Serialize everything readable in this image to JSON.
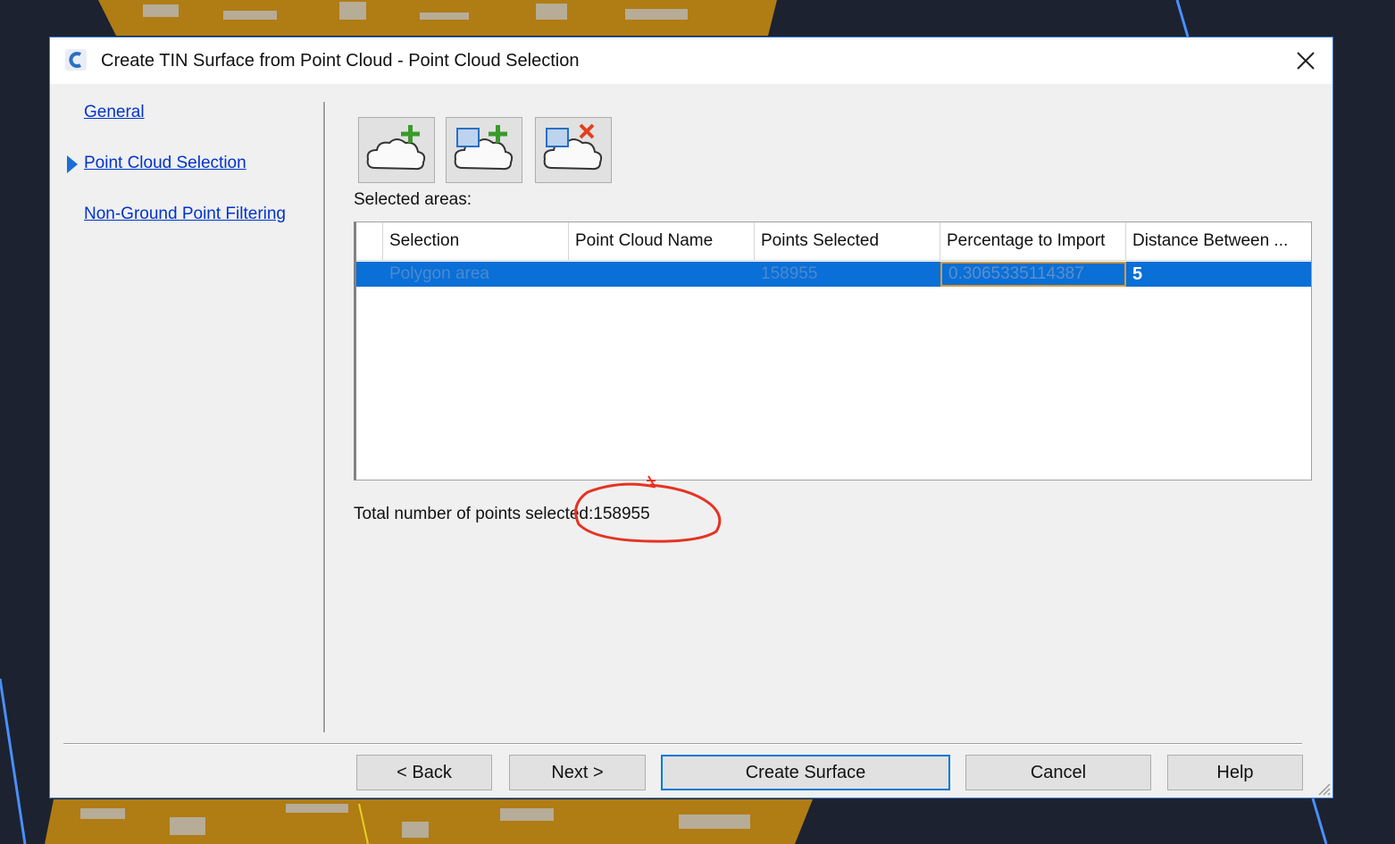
{
  "dialog": {
    "title": "Create TIN Surface from Point Cloud - Point Cloud Selection"
  },
  "nav": {
    "items": [
      {
        "label": "General",
        "active": false
      },
      {
        "label": "Point Cloud Selection",
        "active": true
      },
      {
        "label": "Non-Ground Point Filtering",
        "active": false
      }
    ]
  },
  "toolbar": {
    "buttons": [
      {
        "icon": "add-point-cloud-icon"
      },
      {
        "icon": "add-polygon-area-icon"
      },
      {
        "icon": "remove-area-icon"
      }
    ]
  },
  "selected_areas_label": "Selected areas:",
  "grid": {
    "columns": [
      "Selection",
      "Point Cloud Name",
      "Points Selected",
      "Percentage to Import",
      "Distance Between ..."
    ],
    "rows": [
      {
        "selection": "Polygon area",
        "point_cloud_name": "",
        "points_selected": "158955",
        "percentage": "0.3065335114387",
        "distance": "5",
        "selected": true
      }
    ]
  },
  "total_points_text": "Total number of points selected:158955",
  "buttons": {
    "back": "< Back",
    "next": "Next >",
    "create": "Create Surface",
    "cancel": "Cancel",
    "help": "Help"
  },
  "colors": {
    "selection_blue": "#0a6fd6",
    "link_blue": "#0033cc",
    "annotation_red": "#e53323",
    "cloud_orange": "#b8860b"
  }
}
